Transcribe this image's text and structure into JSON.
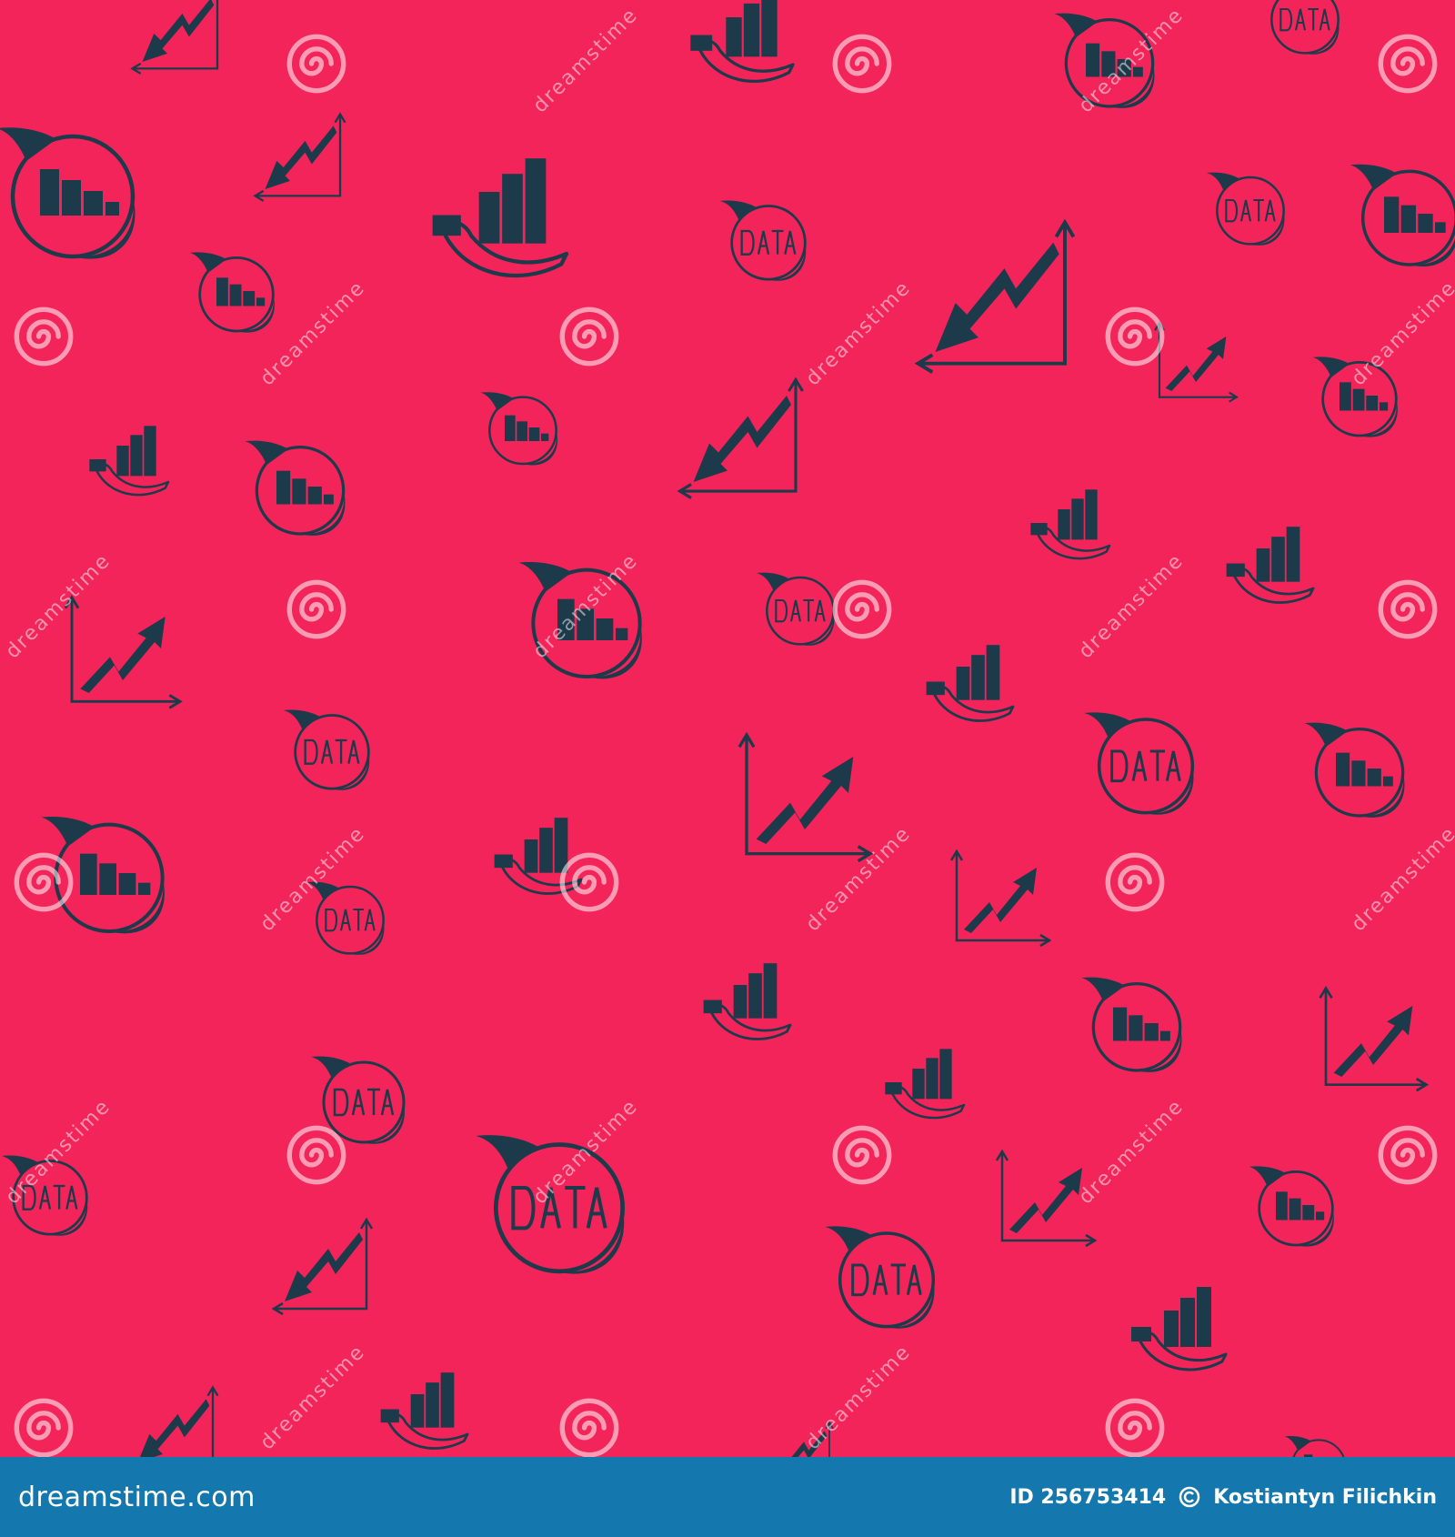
{
  "colors": {
    "background": "#f2245a",
    "icon": "#1d3a4b",
    "watermark": "#ffffff",
    "footer_bar": "#1477ad",
    "footer_text": "#ffffff"
  },
  "pattern": {
    "speech_bubble_text": "DATA",
    "watermark_text": "dreamstime",
    "icon_names": [
      "hand-holding-bar-chart-icon",
      "speech-bubble-bar-chart-icon",
      "speech-bubble-data-icon",
      "chart-arrow-up-icon",
      "chart-arrow-down-icon",
      "dreamstime-spiral-logo-icon"
    ]
  },
  "footer": {
    "brand": "dreamstime.com",
    "image_id": "ID 256753414",
    "author": "Kostiantyn Filichkin"
  }
}
